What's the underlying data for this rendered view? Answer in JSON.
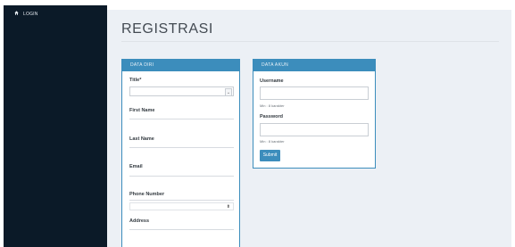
{
  "sidebar": {
    "login_label": "LOGIN",
    "login_icon": "home-icon"
  },
  "page": {
    "title": "REGISTRASI"
  },
  "data_diri": {
    "heading": "DATA DIRI",
    "fields": {
      "title": {
        "label": "Title*",
        "value": ""
      },
      "first_name": {
        "label": "First Name",
        "value": ""
      },
      "last_name": {
        "label": "Last Name",
        "value": ""
      },
      "email": {
        "label": "Email",
        "value": ""
      },
      "phone": {
        "label": "Phone Number",
        "value": ""
      },
      "address": {
        "label": "Address",
        "value": ""
      }
    }
  },
  "data_akun": {
    "heading": "DATA AKUN",
    "username": {
      "label": "Username",
      "value": "",
      "hint": "Min : 8 karakter"
    },
    "password": {
      "label": "Password",
      "value": "",
      "hint": "Min : 8 karakter"
    },
    "submit_label": "Submit"
  },
  "colors": {
    "sidebar": "#0b1a28",
    "accent": "#3c8dbc",
    "content_bg": "#ecf0f5"
  }
}
